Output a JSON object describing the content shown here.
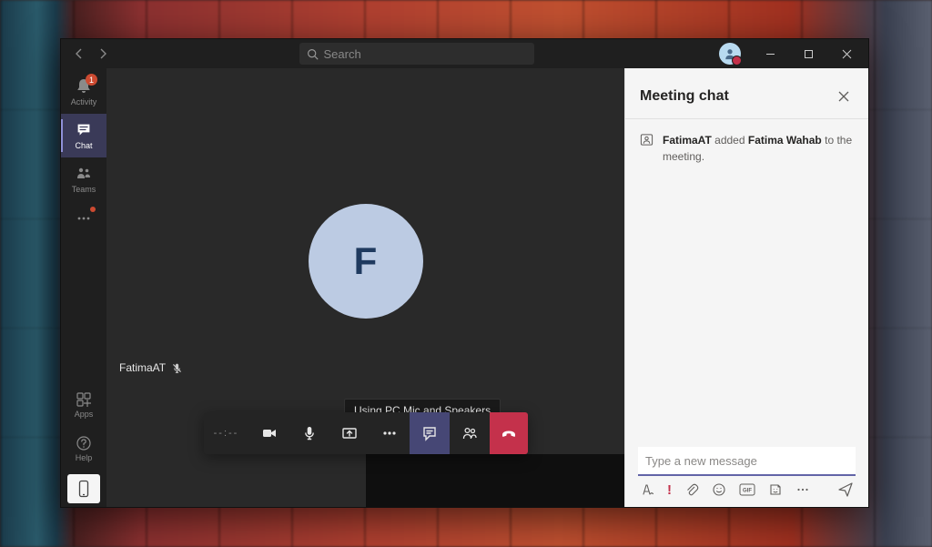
{
  "search": {
    "placeholder": "Search"
  },
  "titlebar": {
    "avatar_status": "busy"
  },
  "leftnav": {
    "items": [
      {
        "id": "activity",
        "label": "Activity",
        "badge": "1"
      },
      {
        "id": "chat",
        "label": "Chat",
        "active": true
      },
      {
        "id": "teams",
        "label": "Teams"
      },
      {
        "id": "more",
        "label": "",
        "dot": true
      }
    ],
    "apps_label": "Apps",
    "help_label": "Help"
  },
  "call": {
    "participant_name": "FatimaAT",
    "participant_muted": true,
    "avatar_initial": "F",
    "tooltip": "Using PC Mic and Speakers",
    "timer": "--:--"
  },
  "chat": {
    "title": "Meeting chat",
    "system_message": {
      "actor": "FatimaAT",
      "verb": "added",
      "target": "Fatima Wahab",
      "tail": "to the meeting."
    },
    "compose_placeholder": "Type a new message"
  }
}
